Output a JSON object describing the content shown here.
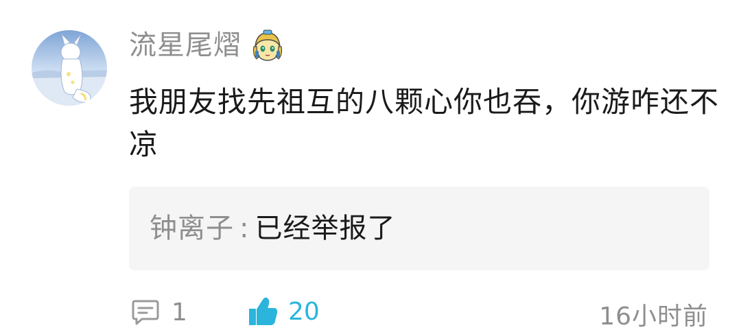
{
  "comment": {
    "username": "流星尾熠",
    "avatar_icon": "fox-avatar",
    "badge_icon": "level-badge-icon",
    "text": "我朋友找先祖互的八颗心你也吞，你游咋还不凉"
  },
  "reply": {
    "author": "钟离子",
    "separator": ":",
    "content": "已经举报了"
  },
  "footer": {
    "comment_count": "1",
    "like_count": "20",
    "timestamp": "16小时前"
  },
  "colors": {
    "accent": "#2bb5dc",
    "muted_text": "#8e8e8e",
    "reply_background": "#f5f5f5"
  }
}
